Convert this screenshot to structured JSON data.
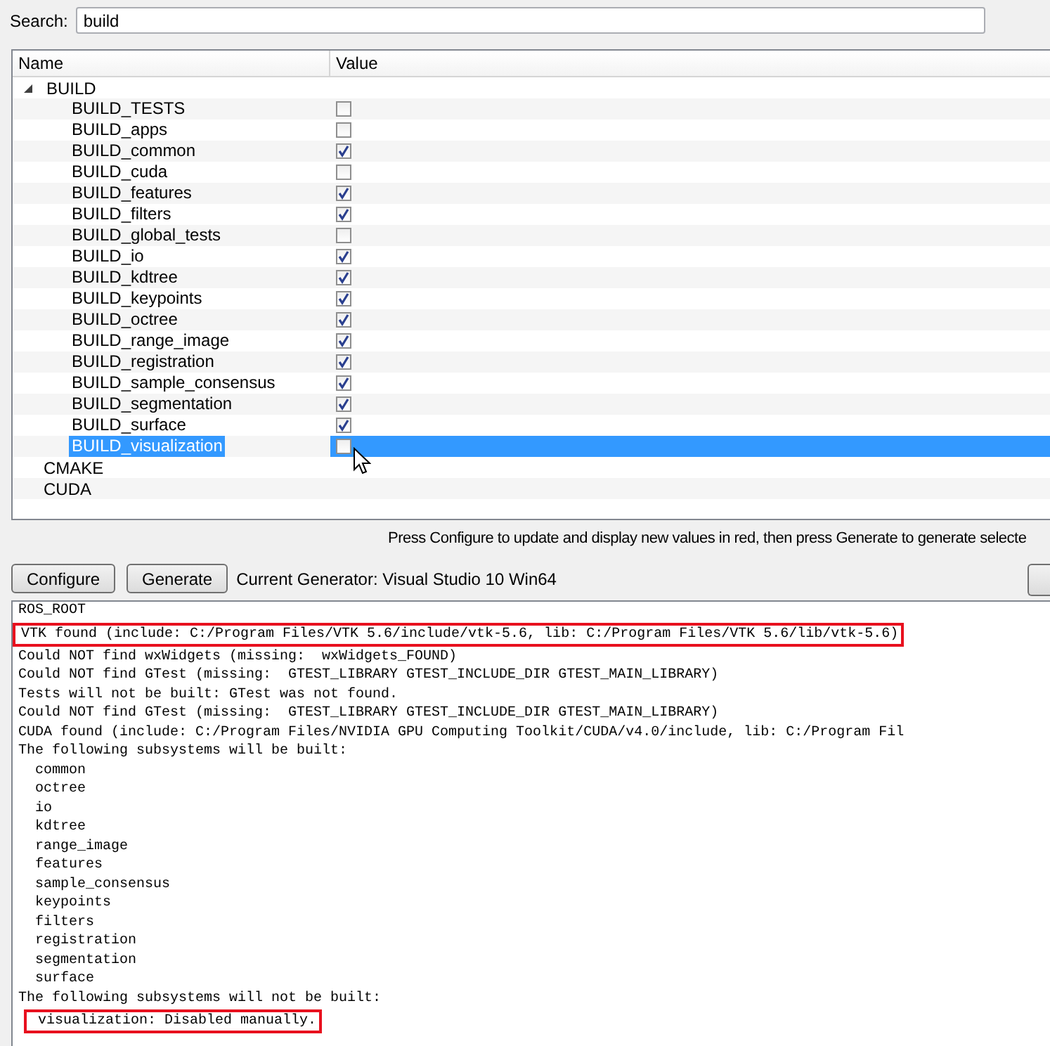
{
  "search": {
    "label": "Search:",
    "value": "build"
  },
  "table": {
    "columns": [
      "Name",
      "Value"
    ],
    "groups": [
      {
        "name": "BUILD",
        "expanded": true,
        "children": [
          {
            "name": "BUILD_TESTS",
            "checked": false,
            "selected": false
          },
          {
            "name": "BUILD_apps",
            "checked": false,
            "selected": false
          },
          {
            "name": "BUILD_common",
            "checked": true,
            "selected": false
          },
          {
            "name": "BUILD_cuda",
            "checked": false,
            "selected": false
          },
          {
            "name": "BUILD_features",
            "checked": true,
            "selected": false
          },
          {
            "name": "BUILD_filters",
            "checked": true,
            "selected": false
          },
          {
            "name": "BUILD_global_tests",
            "checked": false,
            "selected": false
          },
          {
            "name": "BUILD_io",
            "checked": true,
            "selected": false
          },
          {
            "name": "BUILD_kdtree",
            "checked": true,
            "selected": false
          },
          {
            "name": "BUILD_keypoints",
            "checked": true,
            "selected": false
          },
          {
            "name": "BUILD_octree",
            "checked": true,
            "selected": false
          },
          {
            "name": "BUILD_range_image",
            "checked": true,
            "selected": false
          },
          {
            "name": "BUILD_registration",
            "checked": true,
            "selected": false
          },
          {
            "name": "BUILD_sample_consensus",
            "checked": true,
            "selected": false
          },
          {
            "name": "BUILD_segmentation",
            "checked": true,
            "selected": false
          },
          {
            "name": "BUILD_surface",
            "checked": true,
            "selected": false
          },
          {
            "name": "BUILD_visualization",
            "checked": false,
            "selected": true
          }
        ]
      },
      {
        "name": "CMAKE",
        "expanded": false
      },
      {
        "name": "CUDA",
        "expanded": false
      }
    ]
  },
  "hint": "Press Configure to update and display new values in red, then press Generate to generate selecte",
  "buttons": [
    "Configure",
    "Generate"
  ],
  "generator": "Current Generator: Visual Studio 10 Win64",
  "log": [
    {
      "text": "ROS_ROOT",
      "indented": false,
      "highlighted": false
    },
    {
      "text": "VTK found (include: C:/Program Files/VTK 5.6/include/vtk-5.6, lib: C:/Program Files/VTK 5.6/lib/vtk-5.6)",
      "indented": false,
      "highlighted": true
    },
    {
      "text": "Could NOT find wxWidgets (missing:  wxWidgets_FOUND)",
      "indented": false,
      "highlighted": false
    },
    {
      "text": "Could NOT find GTest (missing:  GTEST_LIBRARY GTEST_INCLUDE_DIR GTEST_MAIN_LIBRARY)",
      "indented": false,
      "highlighted": false
    },
    {
      "text": "Tests will not be built: GTest was not found.",
      "indented": false,
      "highlighted": false
    },
    {
      "text": "Could NOT find GTest (missing:  GTEST_LIBRARY GTEST_INCLUDE_DIR GTEST_MAIN_LIBRARY)",
      "indented": false,
      "highlighted": false
    },
    {
      "text": "CUDA found (include: C:/Program Files/NVIDIA GPU Computing Toolkit/CUDA/v4.0/include, lib: C:/Program Fil",
      "indented": false,
      "highlighted": false
    },
    {
      "text": "The following subsystems will be built:",
      "indented": false,
      "highlighted": false
    },
    {
      "text": "common",
      "indented": true,
      "highlighted": false
    },
    {
      "text": "octree",
      "indented": true,
      "highlighted": false
    },
    {
      "text": "io",
      "indented": true,
      "highlighted": false
    },
    {
      "text": "kdtree",
      "indented": true,
      "highlighted": false
    },
    {
      "text": "range_image",
      "indented": true,
      "highlighted": false
    },
    {
      "text": "features",
      "indented": true,
      "highlighted": false
    },
    {
      "text": "sample_consensus",
      "indented": true,
      "highlighted": false
    },
    {
      "text": "keypoints",
      "indented": true,
      "highlighted": false
    },
    {
      "text": "filters",
      "indented": true,
      "highlighted": false
    },
    {
      "text": "registration",
      "indented": true,
      "highlighted": false
    },
    {
      "text": "segmentation",
      "indented": true,
      "highlighted": false
    },
    {
      "text": "surface",
      "indented": true,
      "highlighted": false
    },
    {
      "text": "The following subsystems will not be built:",
      "indented": false,
      "highlighted": false
    },
    {
      "text": "visualization: Disabled manually.",
      "indented": true,
      "highlighted": true
    }
  ]
}
